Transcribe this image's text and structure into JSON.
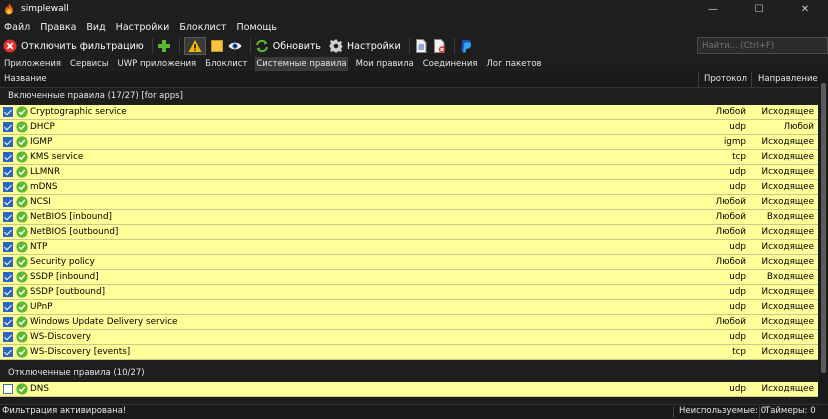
{
  "window": {
    "title": "simplewall",
    "minimize": "—",
    "maximize": "☐",
    "close": "✕"
  },
  "menu": [
    "Файл",
    "Правка",
    "Вид",
    "Настройки",
    "Блоклист",
    "Помощь"
  ],
  "toolbar": {
    "disable_filtering_label": "Отключить фильтрацию",
    "refresh_label": "Обновить",
    "settings_label": "Настройки",
    "search_placeholder": "Найти... (Ctrl+F)"
  },
  "tabs": [
    "Приложения",
    "Сервисы",
    "UWP приложения",
    "Блоклист",
    "Системные правила",
    "Мои правила",
    "Соединения",
    "Лог пакетов"
  ],
  "active_tab": "Системные правила",
  "columns": {
    "name": "Название",
    "protocol": "Протокол",
    "direction": "Направление"
  },
  "groups": [
    {
      "title": "Включенные правила (17/27) [for apps]",
      "enabled": true,
      "rows": [
        {
          "name": "Cryptographic service",
          "protocol": "Любой",
          "direction": "Исходящее"
        },
        {
          "name": "DHCP",
          "protocol": "udp",
          "direction": "Любой"
        },
        {
          "name": "IGMP",
          "protocol": "igmp",
          "direction": "Исходящее"
        },
        {
          "name": "KMS service",
          "protocol": "tcp",
          "direction": "Исходящее"
        },
        {
          "name": "LLMNR",
          "protocol": "udp",
          "direction": "Исходящее"
        },
        {
          "name": "mDNS",
          "protocol": "udp",
          "direction": "Исходящее"
        },
        {
          "name": "NCSI",
          "protocol": "Любой",
          "direction": "Исходящее"
        },
        {
          "name": "NetBIOS [inbound]",
          "protocol": "Любой",
          "direction": "Входящее"
        },
        {
          "name": "NetBIOS [outbound]",
          "protocol": "Любой",
          "direction": "Исходящее"
        },
        {
          "name": "NTP",
          "protocol": "udp",
          "direction": "Исходящее"
        },
        {
          "name": "Security policy",
          "protocol": "Любой",
          "direction": "Исходящее"
        },
        {
          "name": "SSDP [inbound]",
          "protocol": "udp",
          "direction": "Входящее"
        },
        {
          "name": "SSDP [outbound]",
          "protocol": "udp",
          "direction": "Исходящее"
        },
        {
          "name": "UPnP",
          "protocol": "udp",
          "direction": "Исходящее"
        },
        {
          "name": "Windows Update Delivery service",
          "protocol": "Любой",
          "direction": "Исходящее"
        },
        {
          "name": "WS-Discovery",
          "protocol": "udp",
          "direction": "Исходящее"
        },
        {
          "name": "WS-Discovery [events]",
          "protocol": "tcp",
          "direction": "Исходящее"
        }
      ]
    },
    {
      "title": "Отключенные правила (10/27)",
      "enabled": false,
      "rows": [
        {
          "name": "DNS",
          "protocol": "udp",
          "direction": "Исходящее"
        }
      ]
    }
  ],
  "status": {
    "left": "Фильтрация активирована!",
    "unused": "Неиспользуемые: 0",
    "timers": "Таймеры: 0"
  },
  "colors": {
    "row_bg": "#ffff99",
    "background": "#1e1e1e",
    "checkbox": "#2a64c4",
    "ok_icon": "#5cb82e"
  }
}
